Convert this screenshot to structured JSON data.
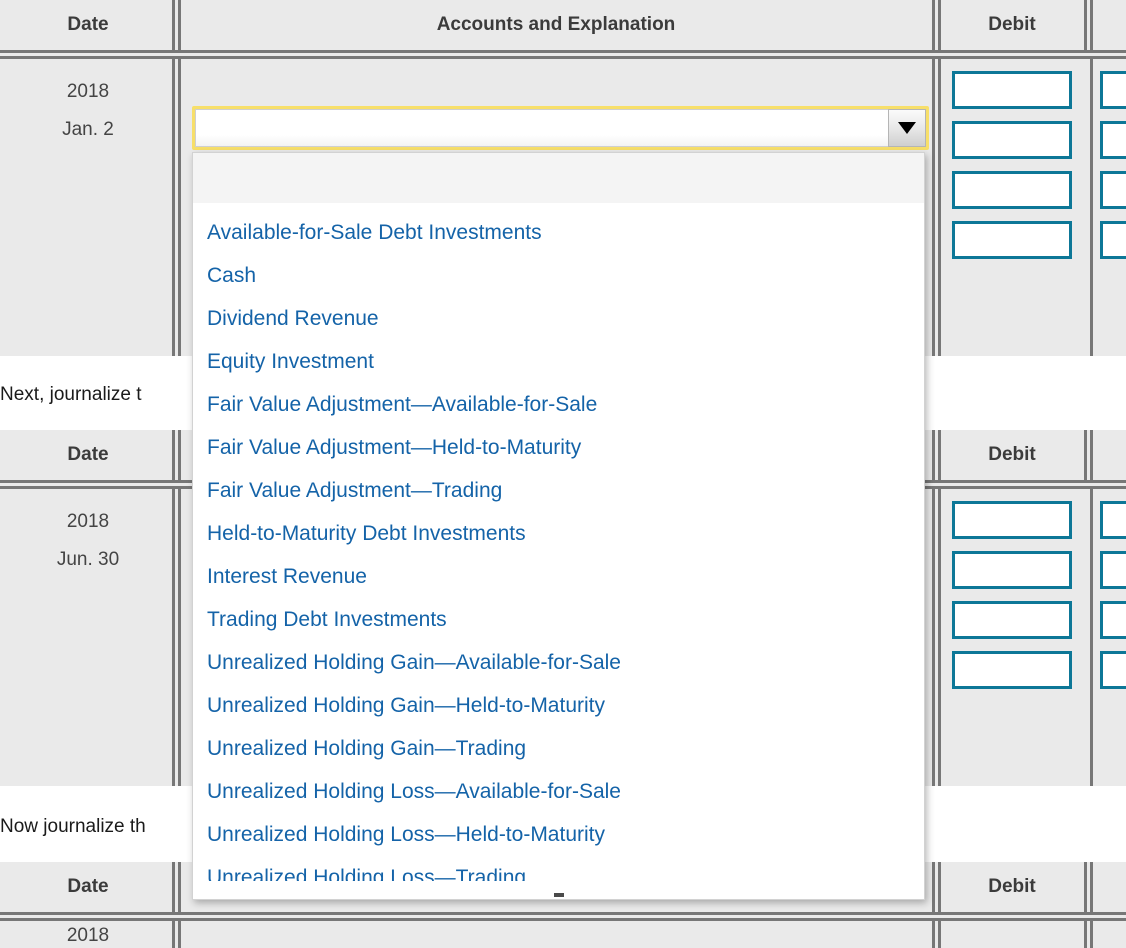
{
  "columns": {
    "date": "Date",
    "accounts": "Accounts and Explanation",
    "debit": "Debit",
    "credit": ""
  },
  "instructions": {
    "second": "Next, journalize t",
    "third": "Now journalize th"
  },
  "journals": [
    {
      "id": "journal-1",
      "date_year": "2018",
      "date_day": "Jan. 2",
      "debit_rows": 4,
      "credit_rows": 4
    },
    {
      "id": "journal-2",
      "date_year": "2018",
      "date_day": "Jun. 30",
      "debit_rows": 4,
      "credit_rows": 4
    },
    {
      "id": "journal-3",
      "date_year": "2018",
      "date_day": "",
      "debit_rows": 0,
      "credit_rows": 0
    }
  ],
  "account_select": {
    "value": "",
    "placeholder": "",
    "arrow_icon": "chevron-down-icon",
    "expanded": true
  },
  "account_options": [
    "",
    "Available-for-Sale Debt Investments",
    "Cash",
    "Dividend Revenue",
    "Equity Investment",
    "Fair Value Adjustment—Available-for-Sale",
    "Fair Value Adjustment—Held-to-Maturity",
    "Fair Value Adjustment—Trading",
    "Held-to-Maturity Debt Investments",
    "Interest Revenue",
    "Trading Debt Investments",
    "Unrealized Holding Gain—Available-for-Sale",
    "Unrealized Holding Gain—Held-to-Maturity",
    "Unrealized Holding Gain—Trading",
    "Unrealized Holding Loss—Available-for-Sale",
    "Unrealized Holding Loss—Held-to-Maturity",
    "Unrealized Holding Loss—Trading"
  ],
  "colors": {
    "option_text": "#1463a8",
    "input_border": "#0d7797",
    "focus_ring": "#f7df6a",
    "table_bg": "#eaeaea",
    "rule": "#777777",
    "header_text": "#3b3b3b"
  }
}
